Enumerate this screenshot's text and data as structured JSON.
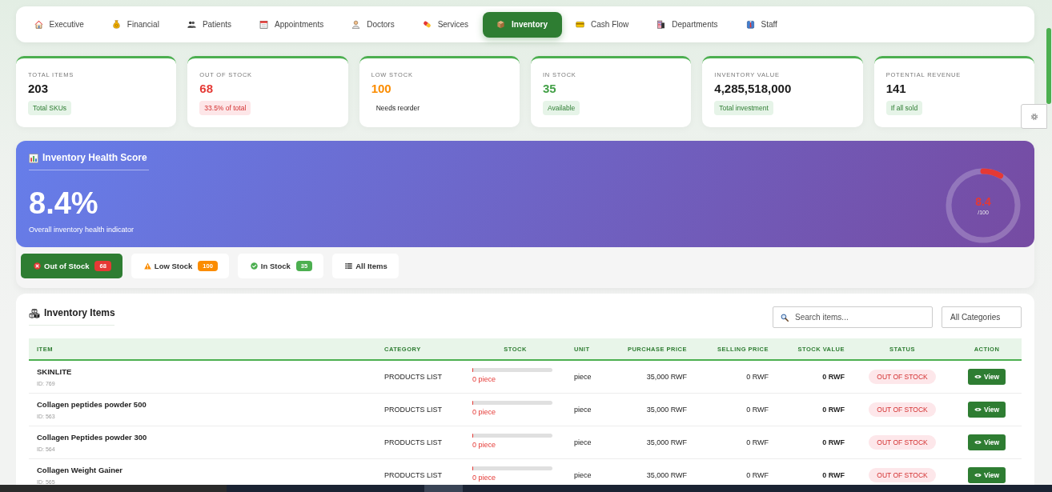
{
  "nav": {
    "tabs": [
      {
        "label": "Executive",
        "selected": false
      },
      {
        "label": "Financial",
        "selected": false
      },
      {
        "label": "Patients",
        "selected": false
      },
      {
        "label": "Appointments",
        "selected": false
      },
      {
        "label": "Doctors",
        "selected": false
      },
      {
        "label": "Services",
        "selected": false
      },
      {
        "label": "Inventory",
        "selected": true
      },
      {
        "label": "Cash Flow",
        "selected": false
      },
      {
        "label": "Departments",
        "selected": false
      },
      {
        "label": "Staff",
        "selected": false
      }
    ]
  },
  "stats": [
    {
      "label": "TOTAL ITEMS",
      "value": "203",
      "color": "#1a1a1a",
      "note": {
        "text": "Total SKUs",
        "kind": "success"
      }
    },
    {
      "label": "OUT OF STOCK",
      "value": "68",
      "color": "#e53935",
      "note": {
        "text": "33.5% of total",
        "kind": "danger"
      }
    },
    {
      "label": "LOW STOCK",
      "value": "100",
      "color": "#fb8c00",
      "note": {
        "text": "Needs reorder",
        "kind": "plain"
      }
    },
    {
      "label": "IN STOCK",
      "value": "35",
      "color": "#43a047",
      "note": {
        "text": "Available",
        "kind": "success"
      }
    },
    {
      "label": "INVENTORY VALUE",
      "value": "4,285,518,000",
      "color": "#1a1a1a",
      "note": {
        "text": "Total investment",
        "kind": "success"
      }
    },
    {
      "label": "POTENTIAL REVENUE",
      "value": "141",
      "color": "#1a1a1a",
      "note": {
        "text": "If all sold",
        "kind": "success"
      }
    }
  ],
  "health": {
    "title": "Inventory Health Score",
    "score": "8.4%",
    "caption": "Overall inventory health indicator",
    "gauge": {
      "level": 0.084,
      "value": "8.4",
      "scale": "/100"
    }
  },
  "filters": [
    {
      "kind": "out",
      "label": "Out of Stock",
      "count": "68",
      "color": "#e53935",
      "selected": true
    },
    {
      "kind": "low",
      "label": "Low Stock",
      "count": "100",
      "color": "#fb8c00",
      "selected": false
    },
    {
      "kind": "in",
      "label": "In Stock",
      "count": "35",
      "color": "#4caf50",
      "selected": false
    },
    {
      "kind": "all",
      "label": "All Items",
      "selected": false
    }
  ],
  "inventory": {
    "title": "Inventory Items",
    "search": {
      "placeholder": "Search items..."
    },
    "category_select": {
      "value": "All Categories"
    },
    "table": {
      "columns": [
        "ITEM",
        "CATEGORY",
        "STOCK",
        "UNIT",
        "PURCHASE PRICE",
        "SELLING PRICE",
        "STOCK VALUE",
        "STATUS",
        "ACTION"
      ],
      "rows": [
        {
          "name": "SKINLITE",
          "id": "ID: 769",
          "category": "PRODUCTS LIST",
          "stock": {
            "level": 0,
            "reading": "0 piece"
          },
          "unit": "piece",
          "purchase_price": "35,000 RWF",
          "selling_price": "0 RWF",
          "stock_value": "0 RWF",
          "status": {
            "text": "OUT OF STOCK",
            "kind": "out"
          },
          "action": "View"
        },
        {
          "name": "Collagen peptides powder 500",
          "id": "ID: 563",
          "category": "PRODUCTS LIST",
          "stock": {
            "level": 0,
            "reading": "0 piece"
          },
          "unit": "piece",
          "purchase_price": "35,000 RWF",
          "selling_price": "0 RWF",
          "stock_value": "0 RWF",
          "status": {
            "text": "OUT OF STOCK",
            "kind": "out"
          },
          "action": "View"
        },
        {
          "name": "Collagen Peptides powder 300",
          "id": "ID: 564",
          "category": "PRODUCTS LIST",
          "stock": {
            "level": 0,
            "reading": "0 piece"
          },
          "unit": "piece",
          "purchase_price": "35,000 RWF",
          "selling_price": "0 RWF",
          "stock_value": "0 RWF",
          "status": {
            "text": "OUT OF STOCK",
            "kind": "out"
          },
          "action": "View"
        },
        {
          "name": "Collagen Weight Gainer",
          "id": "ID: 565",
          "category": "PRODUCTS LIST",
          "stock": {
            "level": 0,
            "reading": "0 piece"
          },
          "unit": "piece",
          "purchase_price": "35,000 RWF",
          "selling_price": "0 RWF",
          "stock_value": "0 RWF",
          "status": {
            "text": "OUT OF STOCK",
            "kind": "out"
          },
          "action": "View"
        }
      ]
    }
  }
}
